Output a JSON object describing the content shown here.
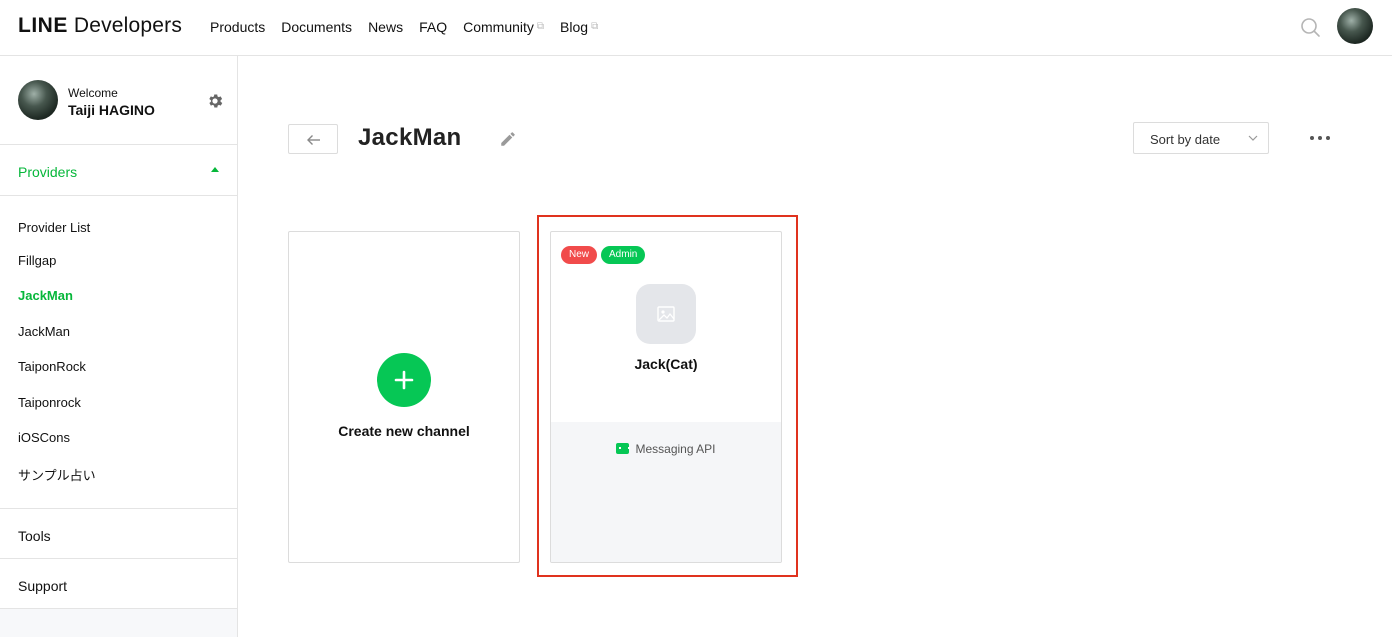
{
  "header": {
    "logo_line": "LINE",
    "logo_dev": "Developers",
    "nav": [
      {
        "label": "Products",
        "external": false
      },
      {
        "label": "Documents",
        "external": false
      },
      {
        "label": "News",
        "external": false
      },
      {
        "label": "FAQ",
        "external": false
      },
      {
        "label": "Community",
        "external": true
      },
      {
        "label": "Blog",
        "external": true
      }
    ],
    "external_glyph": "⧉"
  },
  "sidebar": {
    "welcome": "Welcome",
    "user_name": "Taiji HAGINO",
    "providers_label": "Providers",
    "providers": [
      {
        "label": "Provider List",
        "active": false
      },
      {
        "label": "Fillgap",
        "active": false
      },
      {
        "label": "JackMan",
        "active": true
      },
      {
        "label": "JackMan",
        "active": false
      },
      {
        "label": "TaiponRock",
        "active": false
      },
      {
        "label": "Taiponrock",
        "active": false
      },
      {
        "label": "iOSCons",
        "active": false
      },
      {
        "label": "サンプル占い",
        "active": false
      }
    ],
    "tools_label": "Tools",
    "support_label": "Support"
  },
  "main": {
    "title": "JackMan",
    "sort_label": "Sort by date",
    "create_channel_label": "Create new channel",
    "channels": [
      {
        "name": "Jack(Cat)",
        "badges": [
          {
            "label": "New",
            "color": "#f14b4b"
          },
          {
            "label": "Admin",
            "color": "#06c755"
          }
        ],
        "type": "Messaging API"
      }
    ]
  },
  "colors": {
    "accent_green": "#06c755",
    "active_text_green": "#06b73a",
    "highlight_red": "#e0321e"
  }
}
